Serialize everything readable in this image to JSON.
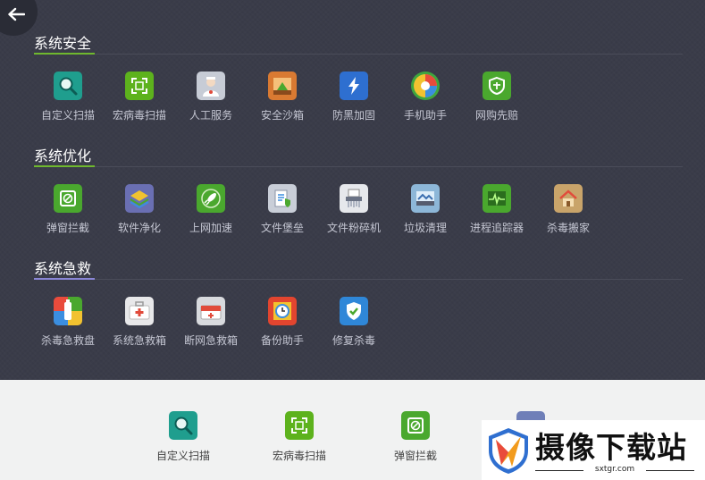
{
  "sections": [
    {
      "title": "系统安全",
      "accent": "#6fb82e",
      "tools": [
        {
          "label": "自定义扫描",
          "icon": "magnifier-icon",
          "color": "#1f9e8e"
        },
        {
          "label": "宏病毒扫描",
          "icon": "scan-frame-icon",
          "color": "#5db21d"
        },
        {
          "label": "人工服务",
          "icon": "doctor-icon",
          "color": "#c7ccd6"
        },
        {
          "label": "安全沙箱",
          "icon": "sandbox-icon",
          "color": "#d97a32"
        },
        {
          "label": "防黑加固",
          "icon": "lightning-icon",
          "color": "#2e6fd0"
        },
        {
          "label": "手机助手",
          "icon": "phone-assistant-icon",
          "color": "#3fa53f"
        },
        {
          "label": "网购先赔",
          "icon": "shield-cart-icon",
          "color": "#4aa82e"
        }
      ]
    },
    {
      "title": "系统优化",
      "accent": "#6fb82e",
      "tools": [
        {
          "label": "弹窗拦截",
          "icon": "popup-block-icon",
          "color": "#4aa82e"
        },
        {
          "label": "软件净化",
          "icon": "layers-icon",
          "color": "#6a6fb3"
        },
        {
          "label": "上网加速",
          "icon": "rocket-icon",
          "color": "#4aa82e"
        },
        {
          "label": "文件堡垒",
          "icon": "file-fortress-icon",
          "color": "#c9ced8"
        },
        {
          "label": "文件粉碎机",
          "icon": "shredder-icon",
          "color": "#e6e8ec"
        },
        {
          "label": "垃圾清理",
          "icon": "broom-icon",
          "color": "#8db7d8"
        },
        {
          "label": "进程追踪器",
          "icon": "process-monitor-icon",
          "color": "#4aa82e"
        },
        {
          "label": "杀毒搬家",
          "icon": "house-move-icon",
          "color": "#c9a46a"
        }
      ]
    },
    {
      "title": "系统急救",
      "accent": "#8a86d6",
      "tools": [
        {
          "label": "杀毒急救盘",
          "icon": "usb-rescue-icon",
          "color": "#e94b3c"
        },
        {
          "label": "系统急救箱",
          "icon": "first-aid-kit-icon",
          "color": "#e8e8ea"
        },
        {
          "label": "断网急救箱",
          "icon": "network-aid-kit-icon",
          "color": "#d8dade"
        },
        {
          "label": "备份助手",
          "icon": "backup-clock-icon",
          "color": "#e2452f"
        },
        {
          "label": "修复杀毒",
          "icon": "repair-shield-icon",
          "color": "#2f87d8"
        }
      ]
    }
  ],
  "recent_tools": [
    {
      "label": "自定义扫描",
      "icon": "magnifier-icon",
      "color": "#1f9e8e"
    },
    {
      "label": "宏病毒扫描",
      "icon": "scan-frame-icon",
      "color": "#5db21d"
    },
    {
      "label": "弹窗拦截",
      "icon": "popup-block-icon",
      "color": "#4aa82e"
    }
  ],
  "watermark": {
    "title": "摄像下载站",
    "url": "sxtgr.com"
  }
}
